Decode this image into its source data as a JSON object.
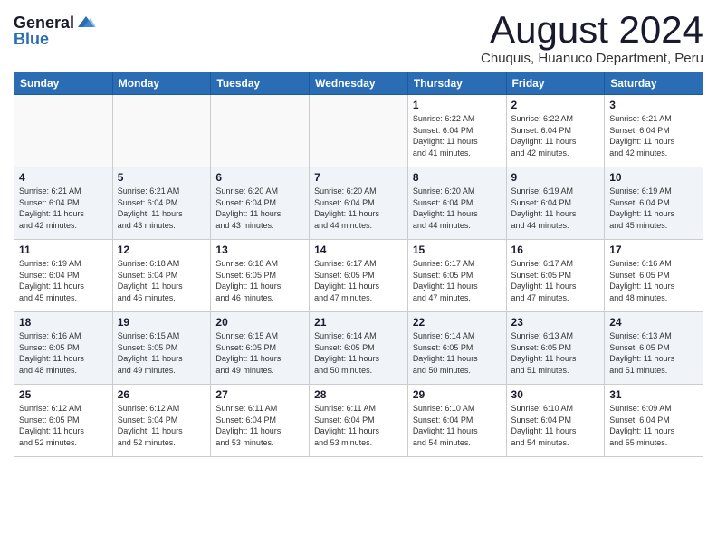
{
  "header": {
    "logo_general": "General",
    "logo_blue": "Blue",
    "month_title": "August 2024",
    "location": "Chuquis, Huanuco Department, Peru"
  },
  "weekdays": [
    "Sunday",
    "Monday",
    "Tuesday",
    "Wednesday",
    "Thursday",
    "Friday",
    "Saturday"
  ],
  "weeks": [
    [
      {
        "day": "",
        "info": ""
      },
      {
        "day": "",
        "info": ""
      },
      {
        "day": "",
        "info": ""
      },
      {
        "day": "",
        "info": ""
      },
      {
        "day": "1",
        "info": "Sunrise: 6:22 AM\nSunset: 6:04 PM\nDaylight: 11 hours\nand 41 minutes."
      },
      {
        "day": "2",
        "info": "Sunrise: 6:22 AM\nSunset: 6:04 PM\nDaylight: 11 hours\nand 42 minutes."
      },
      {
        "day": "3",
        "info": "Sunrise: 6:21 AM\nSunset: 6:04 PM\nDaylight: 11 hours\nand 42 minutes."
      }
    ],
    [
      {
        "day": "4",
        "info": "Sunrise: 6:21 AM\nSunset: 6:04 PM\nDaylight: 11 hours\nand 42 minutes."
      },
      {
        "day": "5",
        "info": "Sunrise: 6:21 AM\nSunset: 6:04 PM\nDaylight: 11 hours\nand 43 minutes."
      },
      {
        "day": "6",
        "info": "Sunrise: 6:20 AM\nSunset: 6:04 PM\nDaylight: 11 hours\nand 43 minutes."
      },
      {
        "day": "7",
        "info": "Sunrise: 6:20 AM\nSunset: 6:04 PM\nDaylight: 11 hours\nand 44 minutes."
      },
      {
        "day": "8",
        "info": "Sunrise: 6:20 AM\nSunset: 6:04 PM\nDaylight: 11 hours\nand 44 minutes."
      },
      {
        "day": "9",
        "info": "Sunrise: 6:19 AM\nSunset: 6:04 PM\nDaylight: 11 hours\nand 44 minutes."
      },
      {
        "day": "10",
        "info": "Sunrise: 6:19 AM\nSunset: 6:04 PM\nDaylight: 11 hours\nand 45 minutes."
      }
    ],
    [
      {
        "day": "11",
        "info": "Sunrise: 6:19 AM\nSunset: 6:04 PM\nDaylight: 11 hours\nand 45 minutes."
      },
      {
        "day": "12",
        "info": "Sunrise: 6:18 AM\nSunset: 6:04 PM\nDaylight: 11 hours\nand 46 minutes."
      },
      {
        "day": "13",
        "info": "Sunrise: 6:18 AM\nSunset: 6:05 PM\nDaylight: 11 hours\nand 46 minutes."
      },
      {
        "day": "14",
        "info": "Sunrise: 6:17 AM\nSunset: 6:05 PM\nDaylight: 11 hours\nand 47 minutes."
      },
      {
        "day": "15",
        "info": "Sunrise: 6:17 AM\nSunset: 6:05 PM\nDaylight: 11 hours\nand 47 minutes."
      },
      {
        "day": "16",
        "info": "Sunrise: 6:17 AM\nSunset: 6:05 PM\nDaylight: 11 hours\nand 47 minutes."
      },
      {
        "day": "17",
        "info": "Sunrise: 6:16 AM\nSunset: 6:05 PM\nDaylight: 11 hours\nand 48 minutes."
      }
    ],
    [
      {
        "day": "18",
        "info": "Sunrise: 6:16 AM\nSunset: 6:05 PM\nDaylight: 11 hours\nand 48 minutes."
      },
      {
        "day": "19",
        "info": "Sunrise: 6:15 AM\nSunset: 6:05 PM\nDaylight: 11 hours\nand 49 minutes."
      },
      {
        "day": "20",
        "info": "Sunrise: 6:15 AM\nSunset: 6:05 PM\nDaylight: 11 hours\nand 49 minutes."
      },
      {
        "day": "21",
        "info": "Sunrise: 6:14 AM\nSunset: 6:05 PM\nDaylight: 11 hours\nand 50 minutes."
      },
      {
        "day": "22",
        "info": "Sunrise: 6:14 AM\nSunset: 6:05 PM\nDaylight: 11 hours\nand 50 minutes."
      },
      {
        "day": "23",
        "info": "Sunrise: 6:13 AM\nSunset: 6:05 PM\nDaylight: 11 hours\nand 51 minutes."
      },
      {
        "day": "24",
        "info": "Sunrise: 6:13 AM\nSunset: 6:05 PM\nDaylight: 11 hours\nand 51 minutes."
      }
    ],
    [
      {
        "day": "25",
        "info": "Sunrise: 6:12 AM\nSunset: 6:05 PM\nDaylight: 11 hours\nand 52 minutes."
      },
      {
        "day": "26",
        "info": "Sunrise: 6:12 AM\nSunset: 6:04 PM\nDaylight: 11 hours\nand 52 minutes."
      },
      {
        "day": "27",
        "info": "Sunrise: 6:11 AM\nSunset: 6:04 PM\nDaylight: 11 hours\nand 53 minutes."
      },
      {
        "day": "28",
        "info": "Sunrise: 6:11 AM\nSunset: 6:04 PM\nDaylight: 11 hours\nand 53 minutes."
      },
      {
        "day": "29",
        "info": "Sunrise: 6:10 AM\nSunset: 6:04 PM\nDaylight: 11 hours\nand 54 minutes."
      },
      {
        "day": "30",
        "info": "Sunrise: 6:10 AM\nSunset: 6:04 PM\nDaylight: 11 hours\nand 54 minutes."
      },
      {
        "day": "31",
        "info": "Sunrise: 6:09 AM\nSunset: 6:04 PM\nDaylight: 11 hours\nand 55 minutes."
      }
    ]
  ]
}
